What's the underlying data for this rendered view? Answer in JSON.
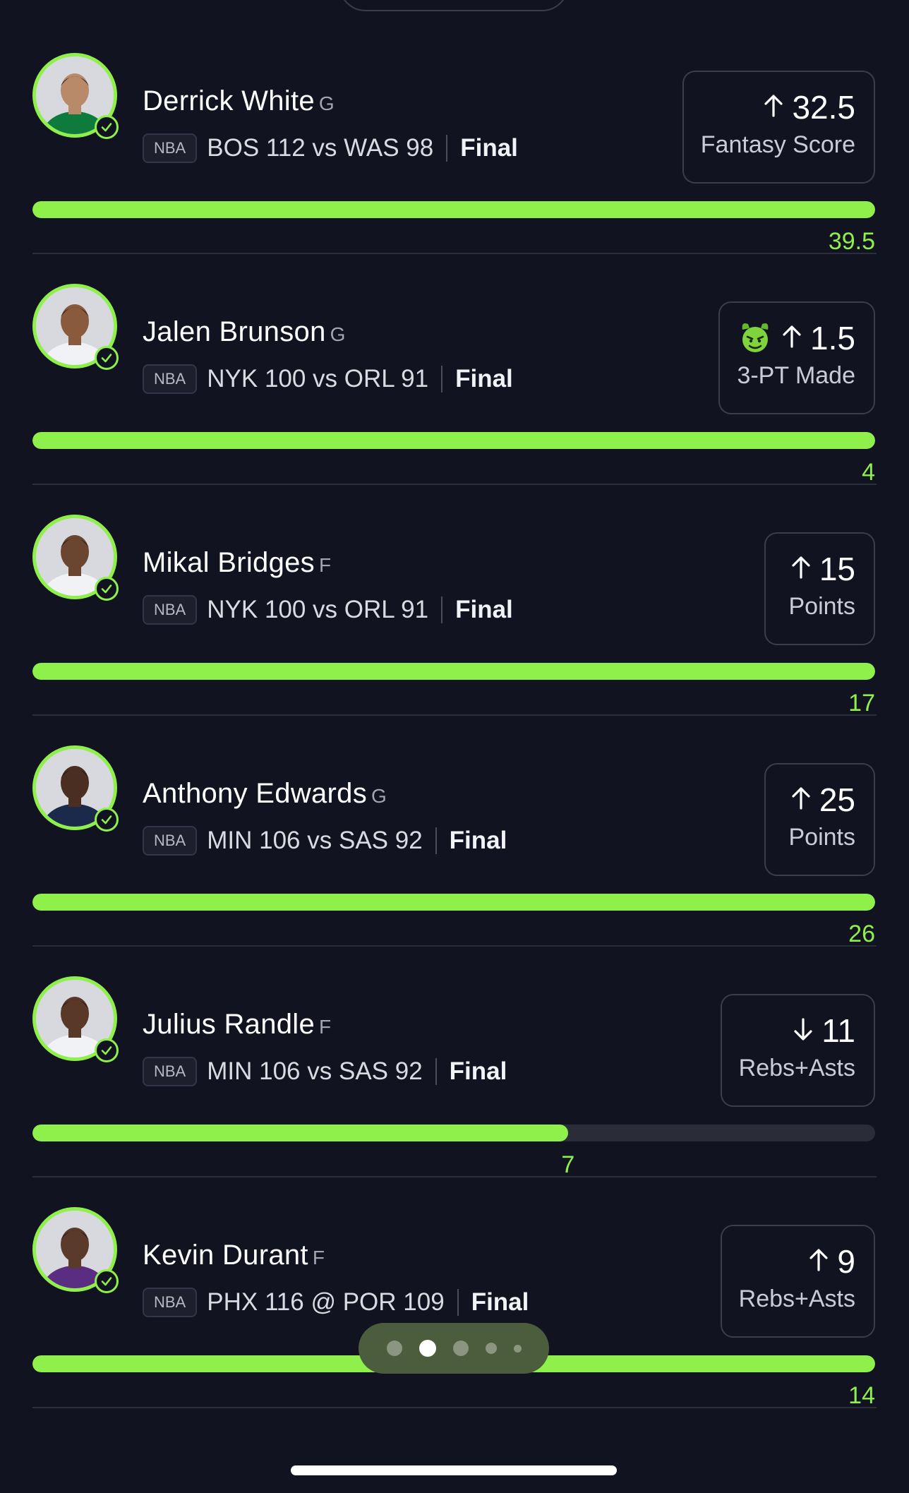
{
  "accent_color": "#8ff04b",
  "background_color": "#121320",
  "players": [
    {
      "name": "Derrick White",
      "position": "G",
      "league": "NBA",
      "game": "BOS 112 vs WAS 98",
      "status": "Final",
      "direction": "up",
      "line": "32.5",
      "stat": "Fantasy Score",
      "actual": "39.5",
      "progress": 1.0,
      "demon": false,
      "jersey_color": "#0e7a3c",
      "skin": "#b98a6a"
    },
    {
      "name": "Jalen Brunson",
      "position": "G",
      "league": "NBA",
      "game": "NYK 100 vs ORL 91",
      "status": "Final",
      "direction": "up",
      "line": "1.5",
      "stat": "3-PT Made",
      "actual": "4",
      "progress": 1.0,
      "demon": true,
      "jersey_color": "#f1f2f5",
      "skin": "#8a5a3c"
    },
    {
      "name": "Mikal Bridges",
      "position": "F",
      "league": "NBA",
      "game": "NYK 100 vs ORL 91",
      "status": "Final",
      "direction": "up",
      "line": "15",
      "stat": "Points",
      "actual": "17",
      "progress": 1.0,
      "demon": false,
      "jersey_color": "#f1f2f5",
      "skin": "#6a4530"
    },
    {
      "name": "Anthony Edwards",
      "position": "G",
      "league": "NBA",
      "game": "MIN 106 vs SAS 92",
      "status": "Final",
      "direction": "up",
      "line": "25",
      "stat": "Points",
      "actual": "26",
      "progress": 1.0,
      "demon": false,
      "jersey_color": "#1b2a4a",
      "skin": "#4a2e22"
    },
    {
      "name": "Julius Randle",
      "position": "F",
      "league": "NBA",
      "game": "MIN 106 vs SAS 92",
      "status": "Final",
      "direction": "down",
      "line": "11",
      "stat": "Rebs+Asts",
      "actual": "7",
      "progress": 0.636,
      "demon": false,
      "jersey_color": "#f1f2f5",
      "skin": "#5a3828"
    },
    {
      "name": "Kevin Durant",
      "position": "F",
      "league": "NBA",
      "game": "PHX 116 @ POR 109",
      "status": "Final",
      "direction": "up",
      "line": "9",
      "stat": "Rebs+Asts",
      "actual": "14",
      "progress": 1.0,
      "demon": false,
      "jersey_color": "#5a2d82",
      "skin": "#5a3a2a"
    }
  ],
  "pager": {
    "count": 5,
    "active_index": 1
  }
}
